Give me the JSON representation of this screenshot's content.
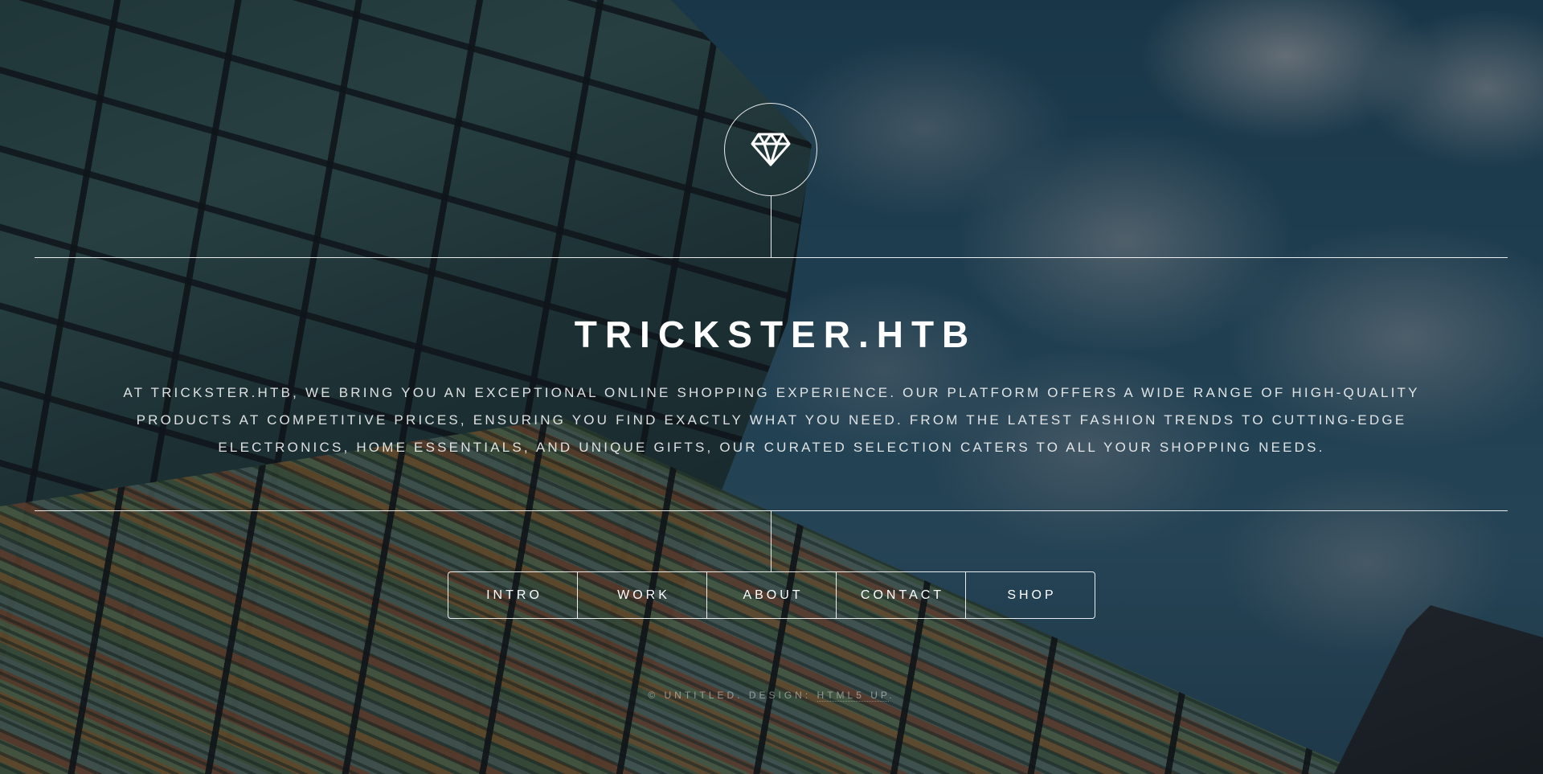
{
  "header": {
    "logo_icon": "diamond-icon",
    "title": "TRICKSTER.HTB",
    "intro": "At Trickster.htb, we bring you an exceptional online shopping experience. Our platform offers a wide range of high-quality products at competitive prices, ensuring you find exactly what you need. From the latest fashion trends to cutting-edge electronics, home essentials, and unique gifts, our curated selection caters to all your shopping needs."
  },
  "nav": {
    "items": [
      {
        "label": "Intro"
      },
      {
        "label": "Work"
      },
      {
        "label": "About"
      },
      {
        "label": "Contact"
      },
      {
        "label": "Shop"
      }
    ]
  },
  "footer": {
    "copyright_prefix": "© Untitled. Design: ",
    "credit_link": "HTML5 UP",
    "copyright_suffix": "."
  },
  "colors": {
    "text": "#ffffff",
    "overlay": "#141a20",
    "line": "#ffffff"
  }
}
